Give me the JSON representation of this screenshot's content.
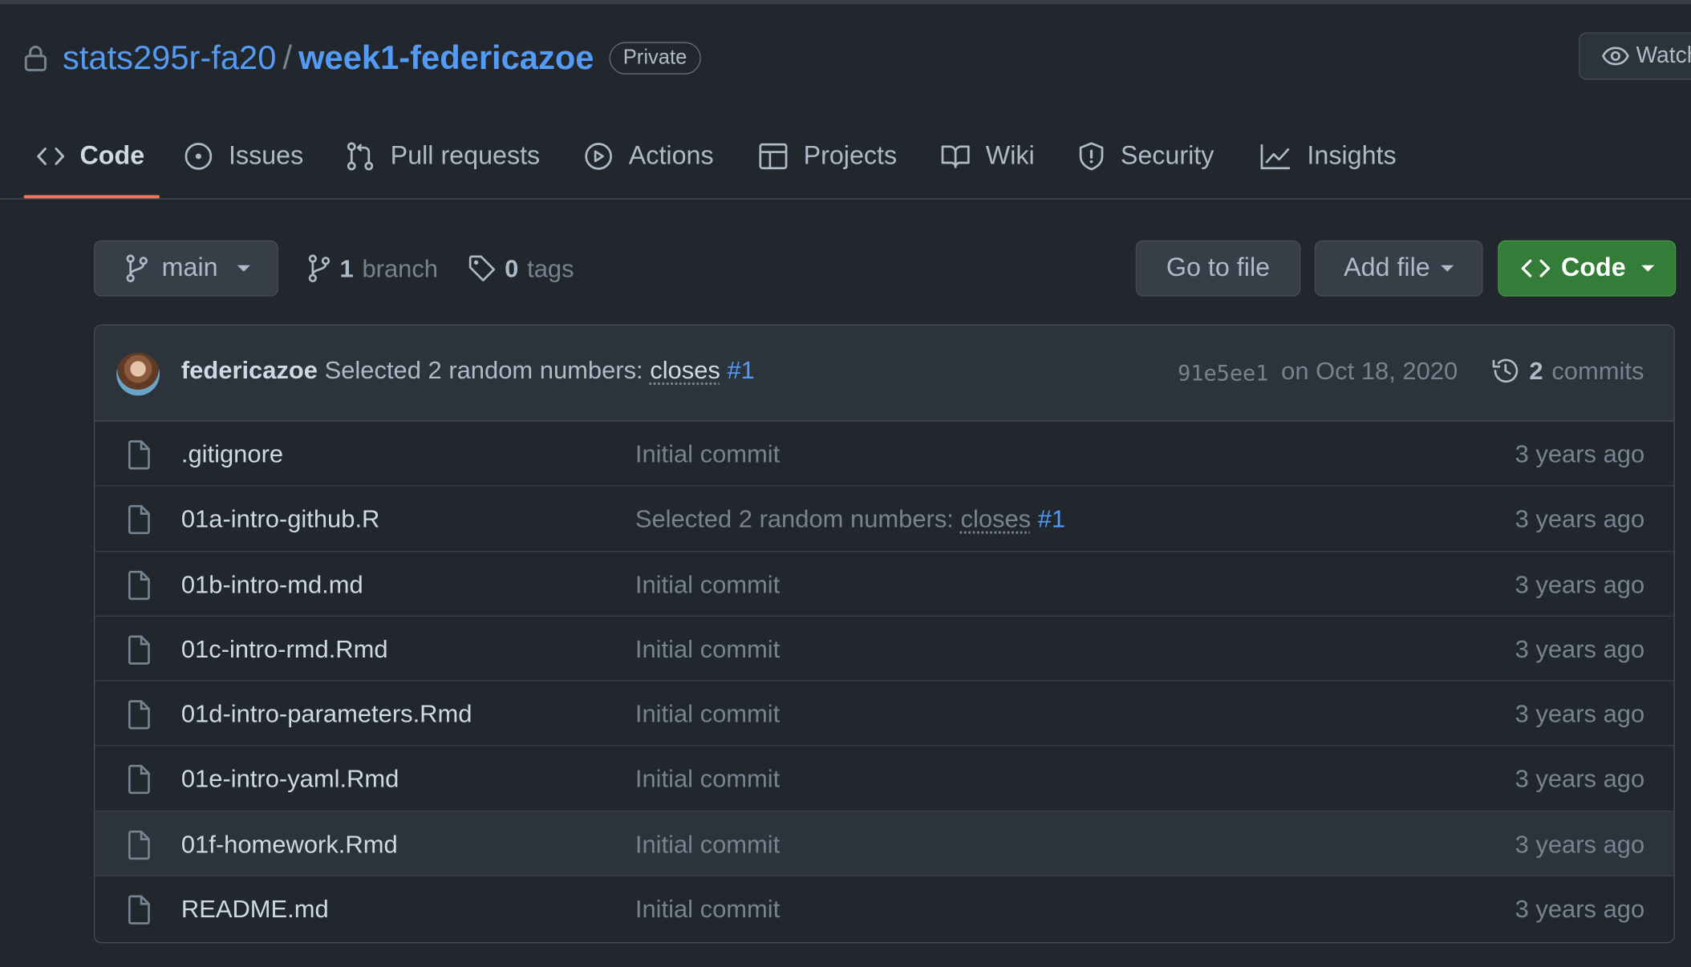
{
  "repo": {
    "owner": "stats295r-fa20",
    "separator": "/",
    "name": "week1-federicazoe",
    "visibility": "Private",
    "watch_label": "Watch"
  },
  "tabs": [
    {
      "label": "Code",
      "icon": "code-icon",
      "active": true
    },
    {
      "label": "Issues",
      "icon": "issue-opened-icon"
    },
    {
      "label": "Pull requests",
      "icon": "git-pull-request-icon"
    },
    {
      "label": "Actions",
      "icon": "play-icon"
    },
    {
      "label": "Projects",
      "icon": "table-icon"
    },
    {
      "label": "Wiki",
      "icon": "book-icon"
    },
    {
      "label": "Security",
      "icon": "shield-icon"
    },
    {
      "label": "Insights",
      "icon": "graph-icon"
    }
  ],
  "toolbar": {
    "branch": "main",
    "branch_count": "1",
    "branch_label": "branch",
    "tag_count": "0",
    "tag_label": "tags",
    "go_to_file": "Go to file",
    "add_file": "Add file",
    "code_button": "Code"
  },
  "latest_commit": {
    "author": "federicazoe",
    "message": "Selected 2 random numbers:",
    "closes": "closes",
    "issue": "#1",
    "sha": "91e5ee1",
    "date": "on Oct 18, 2020",
    "commit_count": "2",
    "commit_label": "commits"
  },
  "files": [
    {
      "name": ".gitignore",
      "message": "Initial commit",
      "age": "3 years ago"
    },
    {
      "name": "01a-intro-github.R",
      "message": "Selected 2 random numbers:",
      "closes": "closes",
      "issue": "#1",
      "age": "3 years ago"
    },
    {
      "name": "01b-intro-md.md",
      "message": "Initial commit",
      "age": "3 years ago"
    },
    {
      "name": "01c-intro-rmd.Rmd",
      "message": "Initial commit",
      "age": "3 years ago"
    },
    {
      "name": "01d-intro-parameters.Rmd",
      "message": "Initial commit",
      "age": "3 years ago"
    },
    {
      "name": "01e-intro-yaml.Rmd",
      "message": "Initial commit",
      "age": "3 years ago"
    },
    {
      "name": "01f-homework.Rmd",
      "message": "Initial commit",
      "age": "3 years ago",
      "hovered": true
    },
    {
      "name": "README.md",
      "message": "Initial commit",
      "age": "3 years ago"
    }
  ],
  "colors": {
    "background": "#22272e",
    "link": "#539bf5",
    "active_tab_underline": "#ec775c",
    "code_button": "#347d39"
  }
}
